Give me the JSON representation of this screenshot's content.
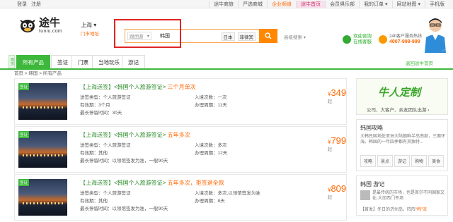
{
  "topbar": {
    "left": [
      "登录",
      "注册"
    ],
    "right": [
      "途牛商旅",
      "严选商城",
      "企业频道",
      "途牛首页",
      "会员俱乐部",
      "我的订单 ▾",
      "网站地图 ▾",
      "手机版"
    ]
  },
  "logo": {
    "cn": "途牛",
    "en": "tuniu.com"
  },
  "city": {
    "name": "上海 ▾",
    "sub": "门市地址"
  },
  "search": {
    "type": "跟团游",
    "value": "韩国",
    "tags": [
      "日本",
      "菲律宾"
    ],
    "advanced": "高级搜索 ▾"
  },
  "service": {
    "online": [
      "欢迎咨询",
      "在线客服"
    ],
    "hotline_label": "24h客户服务热线",
    "hotline": "4007-999-999"
  },
  "nav": {
    "home": "首页",
    "tabs": [
      "所有产品",
      "签证",
      "门票",
      "当地玩乐",
      "游记"
    ],
    "back": "返回途牛首页"
  },
  "breadcrumb": "首页 > 韩国 > 所有产品",
  "products": [
    {
      "badge": "签证",
      "title_prefix": "【上海送签】<韩国个人旅游签证>",
      "title_suffix": "三个月单次",
      "l1": "送签类型：个人旅游签证",
      "l2": "有效期：3个月",
      "l3": "最长停留时间：30天",
      "r1": "入境次数：一次",
      "r2": "办理周期：11天",
      "price": "349",
      "currency": "¥",
      "unit": "起"
    },
    {
      "badge": "签证",
      "title_prefix": "【上海送签】<韩国个人旅游签证>",
      "title_suffix": "五年多次",
      "l1": "送签类型：个人旅游签证",
      "l2": "有效期：其他",
      "l3": "最长停留时间：以领馆签发为准，一般90天",
      "r1": "入境次数：多次",
      "r2": "办理周期：12天",
      "price": "799",
      "currency": "¥",
      "unit": "起"
    },
    {
      "badge": "签证",
      "title_prefix": "【上海送签】<韩国个人旅游签证>",
      "title_suffix": "五年多次，拒签退全款",
      "l1": "送签类型：个人旅游签证",
      "l2": "有效期：其他",
      "l3": "最长停留时间：以领馆签发为准，一般90天",
      "r1": "入境次数：多次,以领馆签发为准",
      "r2": "办理周期：8天",
      "price": "809",
      "currency": "¥",
      "unit": "起"
    }
  ],
  "side": {
    "banner_big": "牛人定制",
    "banner_sub": "公司、大客户、亲友团队出游 ›",
    "guide_title": "韩国攻略",
    "guide_desc": "大韩民国地处亚洲大陆朝鲜半岛南部，三面环海。韩国的一年四季都有其独特...",
    "guide_btns": [
      "攻略",
      "景点",
      "游记",
      "购物",
      "美食"
    ],
    "notes_title": "韩国 游记",
    "notes_d1": "是最传统的市场，也是首尔不同国家文化·大邱西门市场",
    "notes_d2_prefix": "【首发】冬日的济州岛，阵阵",
    "notes_d2_link": "“韩”流"
  },
  "colors": {
    "accent_green": "#3db83b",
    "accent_orange": "#ff6600",
    "highlight_red": "#e02424"
  }
}
